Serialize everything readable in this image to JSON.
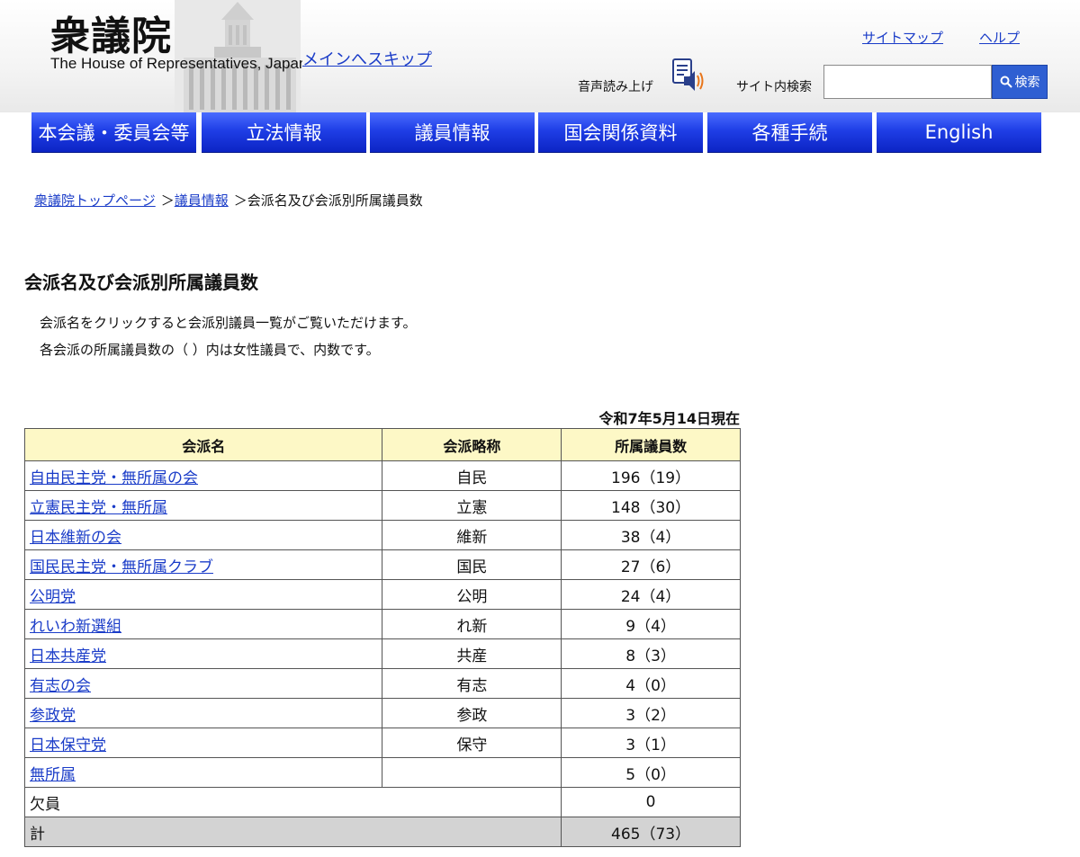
{
  "header": {
    "logo_kanji": "衆議院",
    "logo_english": "The House of Representatives, Japan",
    "skip_link": "メインへスキップ",
    "sitemap": "サイトマップ",
    "help": "ヘルプ",
    "voice_label": "音声読み上げ",
    "search_label": "サイト内検索",
    "search_value": "",
    "search_button": "検索",
    "icons": [
      "speaker-icon",
      "search-icon"
    ]
  },
  "nav": [
    {
      "label": "本会議・委員会等"
    },
    {
      "label": "立法情報"
    },
    {
      "label": "議員情報"
    },
    {
      "label": "国会関係資料"
    },
    {
      "label": "各種手続"
    },
    {
      "label": "English"
    }
  ],
  "breadcrumb": {
    "home": "衆議院トップページ",
    "section": "議員情報",
    "current": "会派名及び会派別所属議員数",
    "separator": "＞"
  },
  "page_title": "会派名及び会派別所属議員数",
  "notes": [
    "会派名をクリックすると会派別議員一覧がご覧いただけます。",
    "各会派の所属議員数の（ ）内は女性議員で、内数です。"
  ],
  "as_of": "令和7年5月14日現在",
  "table": {
    "headers": [
      "会派名",
      "会派略称",
      "所属議員数"
    ],
    "rows": [
      {
        "name": "自由民主党・無所属の会",
        "abbr": "自民",
        "count": "196（19）"
      },
      {
        "name": "立憲民主党・無所属",
        "abbr": "立憲",
        "count": "148（30）"
      },
      {
        "name": "日本維新の会",
        "abbr": "維新",
        "count": "38（4）"
      },
      {
        "name": "国民民主党・無所属クラブ",
        "abbr": "国民",
        "count": "27（6）"
      },
      {
        "name": "公明党",
        "abbr": "公明",
        "count": "24（4）"
      },
      {
        "name": "れいわ新選組",
        "abbr": "れ新",
        "count": "9（4）"
      },
      {
        "name": "日本共産党",
        "abbr": "共産",
        "count": "8（3）"
      },
      {
        "name": "有志の会",
        "abbr": "有志",
        "count": "4（0）"
      },
      {
        "name": "参政党",
        "abbr": "参政",
        "count": "3（2）"
      },
      {
        "name": "日本保守党",
        "abbr": "保守",
        "count": "3（1）"
      },
      {
        "name": "無所属",
        "abbr": "",
        "count": "5（0）"
      }
    ],
    "vacancy": {
      "label": "欠員",
      "count": "0"
    },
    "total": {
      "label": "計",
      "count": "465（73）"
    }
  },
  "colors": {
    "link": "#1a3cc8",
    "nav_blue": "#1f3ee6",
    "header_cell": "#fdf8c6",
    "total_row": "#d3d3d3",
    "search_button": "#2f5fd2",
    "speaker_accent": "#e8751a"
  }
}
